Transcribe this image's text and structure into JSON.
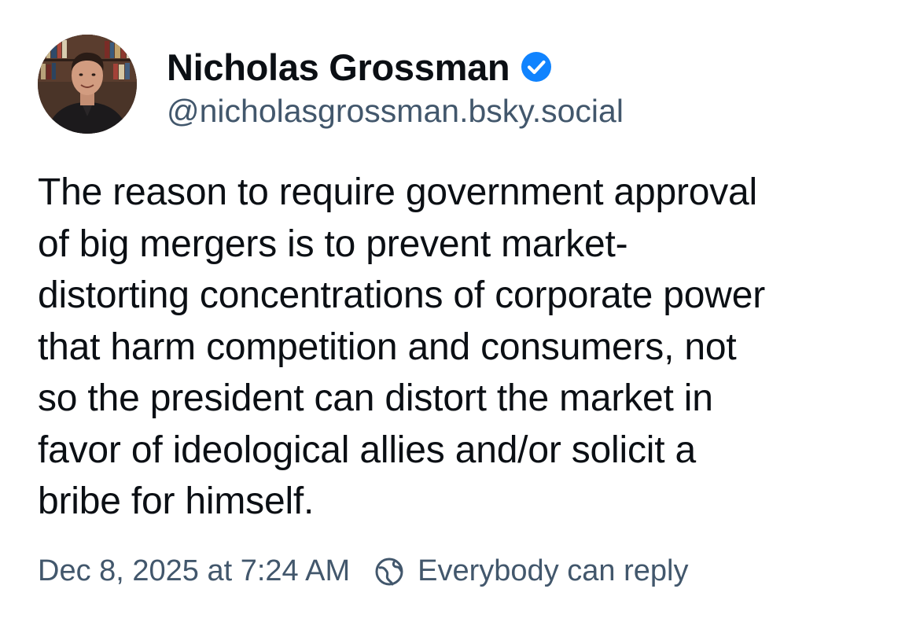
{
  "author": {
    "display_name": "Nicholas Grossman",
    "handle": "@nicholasgrossman.bsky.social",
    "avatar_icon": "profile-photo",
    "verified_icon": "verified-checkmark-icon",
    "verified_color": "#1083fe"
  },
  "post": {
    "lines": [
      "The reason to require government approval",
      "of big mergers is to prevent market-",
      "distorting concentrations of corporate power",
      "that harm competition and consumers, not",
      "so the president can distort the market in",
      "favor of ideological allies and/or solicit a",
      "bribe for himself."
    ]
  },
  "meta": {
    "timestamp": "Dec 8, 2025 at 7:24 AM",
    "reply_icon": "globe-reply-icon",
    "reply_setting": "Everybody can reply"
  },
  "colors": {
    "text_primary": "#0b0f14",
    "text_secondary": "#42576c",
    "background": "#ffffff"
  }
}
